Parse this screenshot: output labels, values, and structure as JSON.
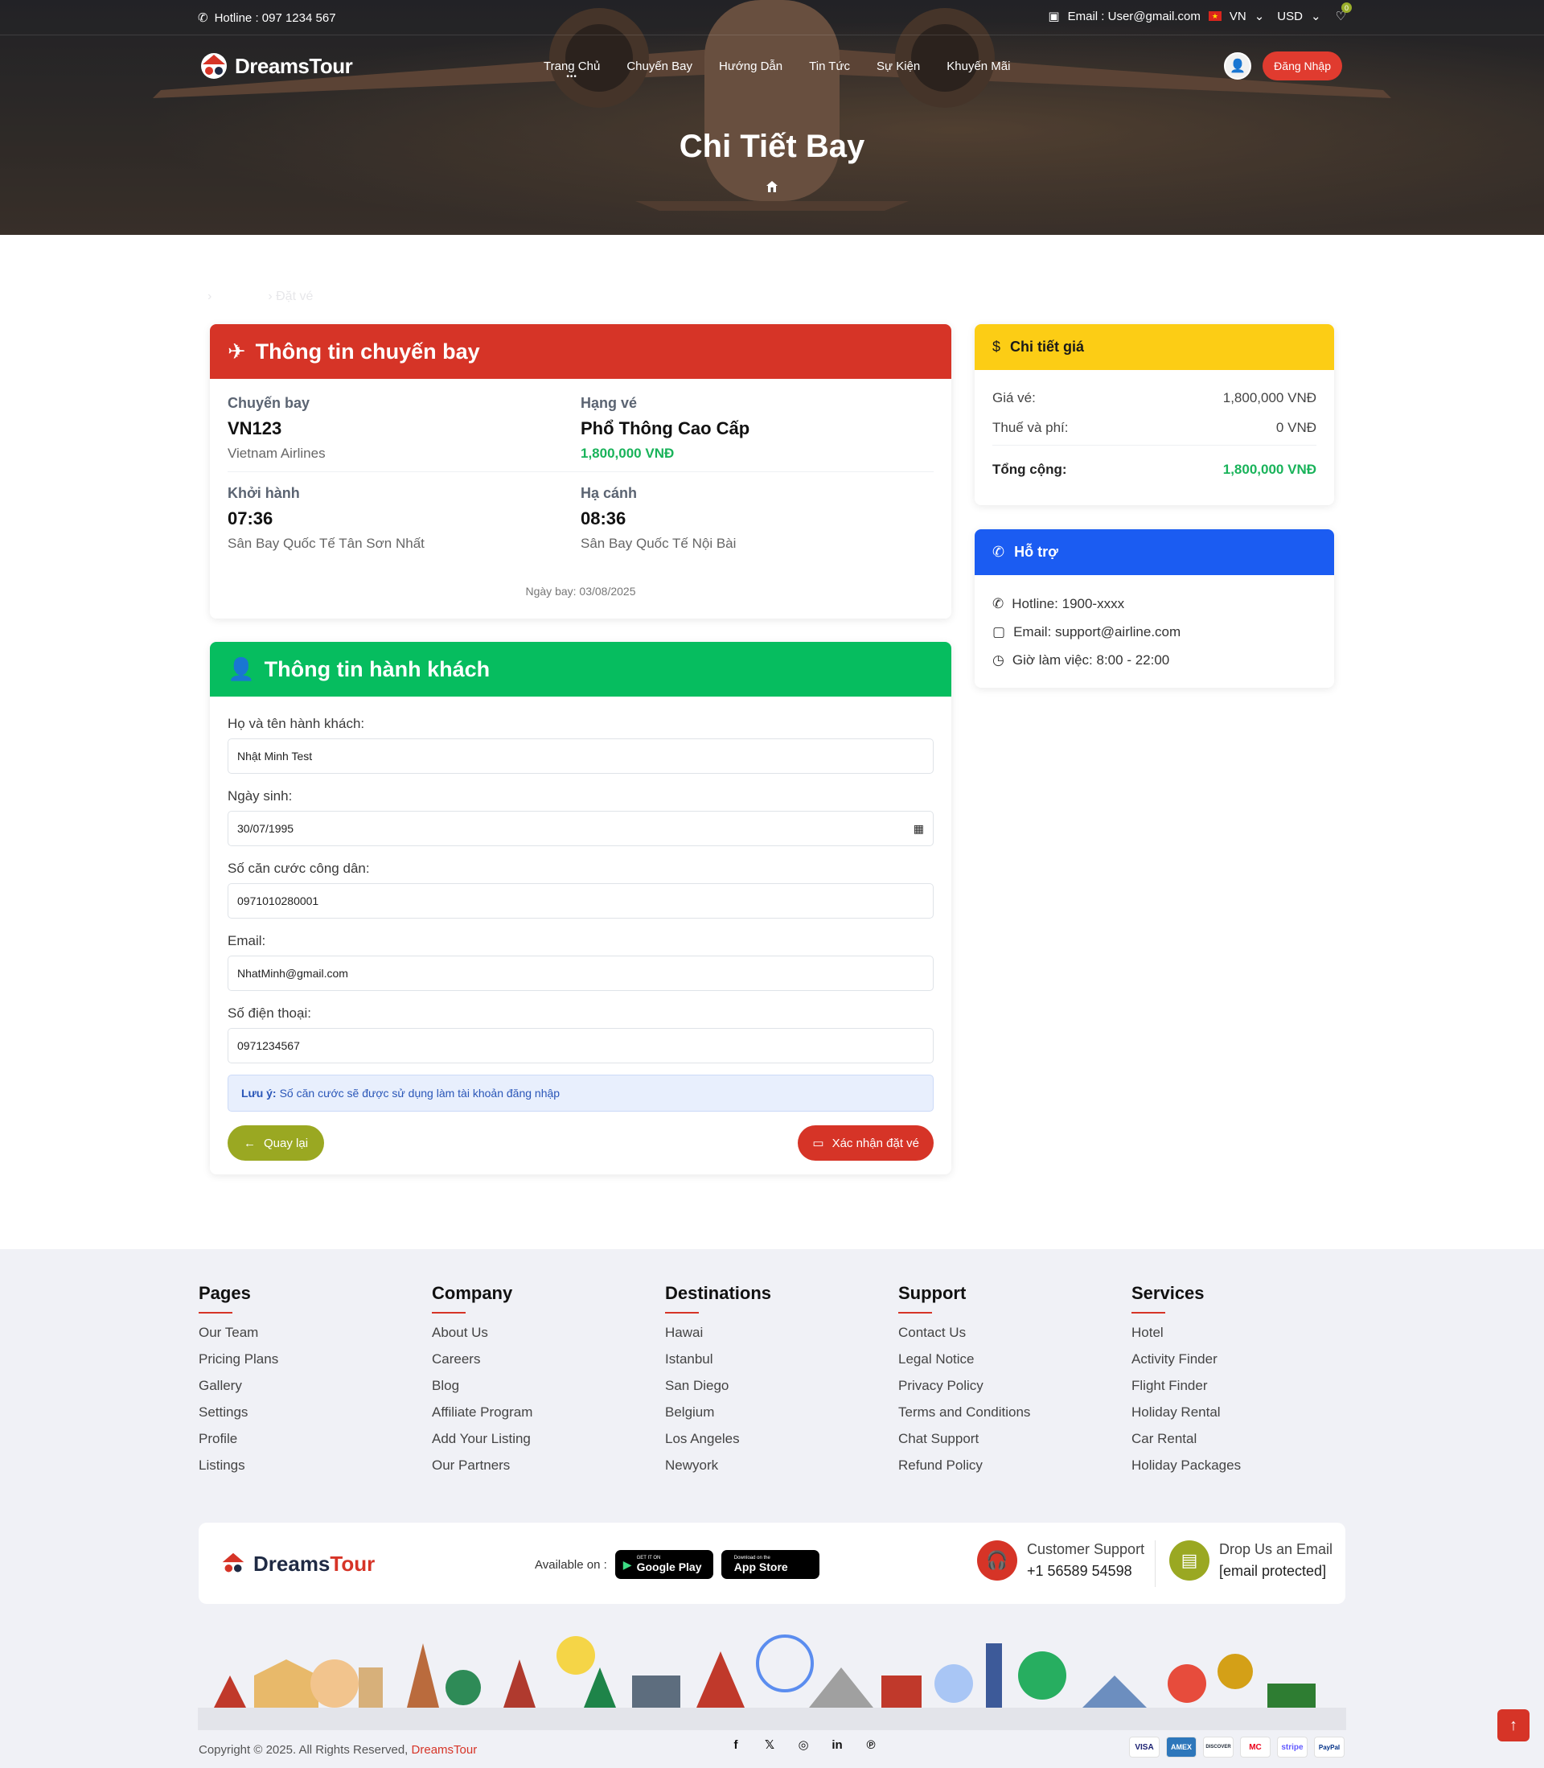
{
  "topbar": {
    "hotline": "Hotline : 097 1234 567",
    "email": "Email : User@gmail.com",
    "language": "VN",
    "currency": "USD",
    "cart_count": "0"
  },
  "nav": {
    "logo": "DreamsTour",
    "items": [
      "Trang Chủ",
      "Chuyến Bay",
      "Hướng Dẫn",
      "Tin Tức",
      "Sự Kiện",
      "Khuyến Mãi"
    ],
    "login": "Đăng Nhập"
  },
  "hero": {
    "title": "Chi Tiết Bay"
  },
  "breadcrumb": {
    "current": "Đặt vé"
  },
  "flight": {
    "header": "Thông tin chuyến bay",
    "flight_label": "Chuyến bay",
    "flight_code": "VN123",
    "airline": "Vietnam Airlines",
    "class_label": "Hạng vé",
    "class_name": "Phổ Thông Cao Cấp",
    "class_price": "1,800,000 VNĐ",
    "depart_label": "Khởi hành",
    "depart_time": "07:36",
    "depart_airport": "Sân Bay Quốc Tế Tân Sơn Nhất",
    "arrive_label": "Hạ cánh",
    "arrive_time": "08:36",
    "arrive_airport": "Sân Bay Quốc Tế Nội Bài",
    "date": "Ngày bay: 03/08/2025"
  },
  "passenger": {
    "header": "Thông tin hành khách",
    "name_label": "Họ và tên hành khách:",
    "name_value": "Nhật Minh Test",
    "dob_label": "Ngày sinh:",
    "dob_value": "30/07/1995",
    "id_label": "Số căn cước công dân:",
    "id_value": "0971010280001",
    "email_label": "Email:",
    "email_value": "NhatMinh@gmail.com",
    "phone_label": "Số điện thoại:",
    "phone_value": "0971234567",
    "note_bold": "Lưu ý:",
    "note_text": "Số căn cước sẽ được sử dụng làm tài khoản đăng nhập",
    "back": "Quay lại",
    "confirm": "Xác nhận đặt vé"
  },
  "price": {
    "header": "Chi tiết giá",
    "fare_label": "Giá vé:",
    "fare_value": "1,800,000 VNĐ",
    "tax_label": "Thuế và phí:",
    "tax_value": "0 VNĐ",
    "total_label": "Tổng cộng:",
    "total_value": "1,800,000 VNĐ"
  },
  "support": {
    "header": "Hỗ trợ",
    "hotline": "Hotline: 1900-xxxx",
    "email": "Email: support@airline.com",
    "hours": "Giờ làm việc: 8:00 - 22:00"
  },
  "footer": {
    "columns": [
      {
        "title": "Pages",
        "links": [
          "Our Team",
          "Pricing Plans",
          "Gallery",
          "Settings",
          "Profile",
          "Listings"
        ]
      },
      {
        "title": "Company",
        "links": [
          "About Us",
          "Careers",
          "Blog",
          "Affiliate Program",
          "Add Your Listing",
          "Our Partners"
        ]
      },
      {
        "title": "Destinations",
        "links": [
          "Hawai",
          "Istanbul",
          "San Diego",
          "Belgium",
          "Los Angeles",
          "Newyork"
        ]
      },
      {
        "title": "Support",
        "links": [
          "Contact Us",
          "Legal Notice",
          "Privacy Policy",
          "Terms and Conditions",
          "Chat Support",
          "Refund Policy"
        ]
      },
      {
        "title": "Services",
        "links": [
          "Hotel",
          "Activity Finder",
          "Flight Finder",
          "Holiday Rental",
          "Car Rental",
          "Holiday Packages"
        ]
      }
    ],
    "logo_a": "Dreams",
    "logo_b": "Tour",
    "available": "Available on :",
    "gplay_small": "GET IT ON",
    "gplay": "Google Play",
    "appstore_small": "Download on the",
    "appstore": "App Store",
    "support_title": "Customer Support",
    "support_phone": "+1 56589 54598",
    "email_title": "Drop Us an Email",
    "email_value": "[email protected]",
    "copyright": "Copyright © 2025. All Rights Reserved,",
    "brand": "DreamsTour",
    "payments": [
      "VISA",
      "AMEX",
      "DISCOVER",
      "MC",
      "stripe",
      "PayPal"
    ]
  },
  "colors": {
    "flight_header": "#d63427",
    "passenger_header": "#06bd5f",
    "price_header": "#fccd15",
    "support_header": "#1b5cf2",
    "price_green": "#19b35a"
  }
}
